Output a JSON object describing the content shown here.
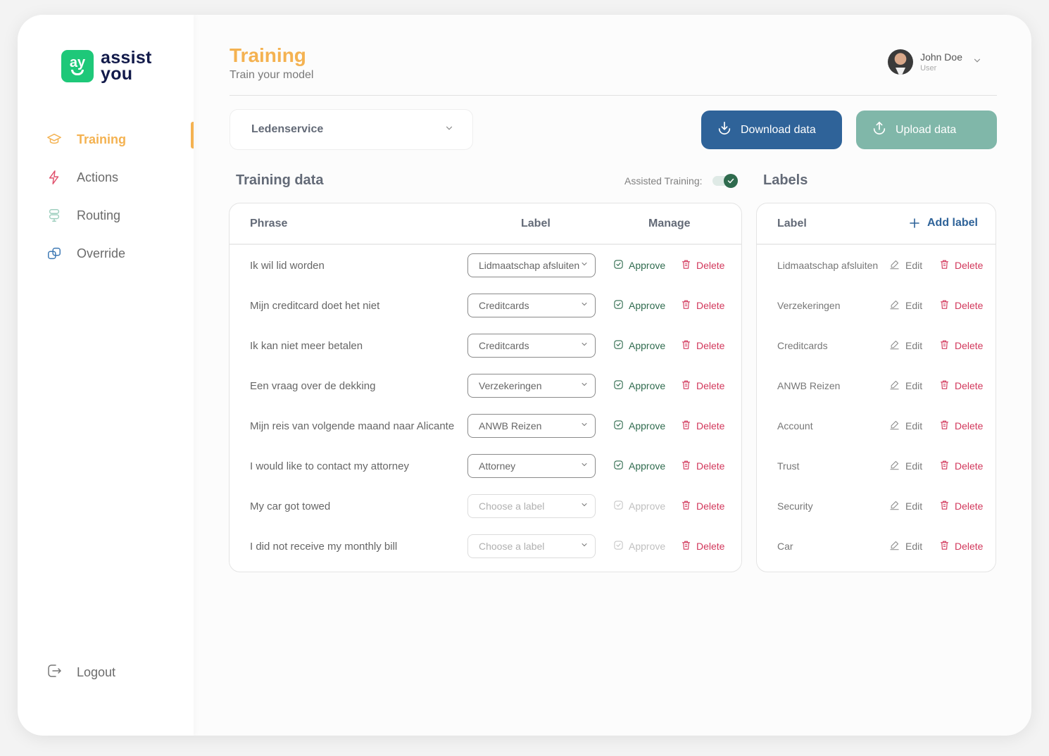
{
  "brand": {
    "mark": "ay",
    "name_line1": "assist",
    "name_line2": "you",
    "color": "#1ec879"
  },
  "sidebar": {
    "items": [
      {
        "label": "Training",
        "icon": "graduation-cap-icon",
        "active": true
      },
      {
        "label": "Actions",
        "icon": "lightning-icon",
        "active": false
      },
      {
        "label": "Routing",
        "icon": "signpost-icon",
        "active": false
      },
      {
        "label": "Override",
        "icon": "copy-icon",
        "active": false
      }
    ],
    "logout_label": "Logout"
  },
  "header": {
    "title": "Training",
    "subtitle": "Train your model"
  },
  "user": {
    "name": "John Doe",
    "role": "User"
  },
  "toolbar": {
    "channel_value": "Ledenservice",
    "download_label": "Download data",
    "upload_label": "Upload data"
  },
  "training": {
    "title": "Training data",
    "assisted_label": "Assisted Training:",
    "assisted_on": true,
    "columns": {
      "phrase": "Phrase",
      "label": "Label",
      "manage": "Manage"
    },
    "approve_label": "Approve",
    "delete_label": "Delete",
    "rows": [
      {
        "phrase": "Ik wil lid worden",
        "label": "Lidmaatschap afsluiten",
        "empty": false
      },
      {
        "phrase": "Mijn creditcard doet het niet",
        "label": "Creditcards",
        "empty": false
      },
      {
        "phrase": "Ik kan niet meer betalen",
        "label": "Creditcards",
        "empty": false
      },
      {
        "phrase": "Een vraag over de dekking",
        "label": "Verzekeringen",
        "empty": false
      },
      {
        "phrase": "Mijn reis van volgende maand naar Alicante",
        "label": "ANWB Reizen",
        "empty": false
      },
      {
        "phrase": "I would like to contact my attorney",
        "label": "Attorney",
        "empty": false
      },
      {
        "phrase": "My car got towed",
        "label": "Choose a label",
        "empty": true
      },
      {
        "phrase": "I did not receive my monthly bill",
        "label": "Choose a label",
        "empty": true
      }
    ]
  },
  "labels": {
    "title": "Labels",
    "column": "Label",
    "add_label": "Add label",
    "edit_label": "Edit",
    "delete_label": "Delete",
    "items": [
      "Lidmaatschap afsluiten",
      "Verzekeringen",
      "Creditcards",
      "ANWB Reizen",
      "Account",
      "Trust",
      "Security",
      "Car"
    ]
  },
  "colors": {
    "accent": "#f4b251",
    "primary": "#2f6399",
    "secondary": "#80b7a9",
    "approve": "#2f6b4e",
    "danger": "#d2375b"
  }
}
